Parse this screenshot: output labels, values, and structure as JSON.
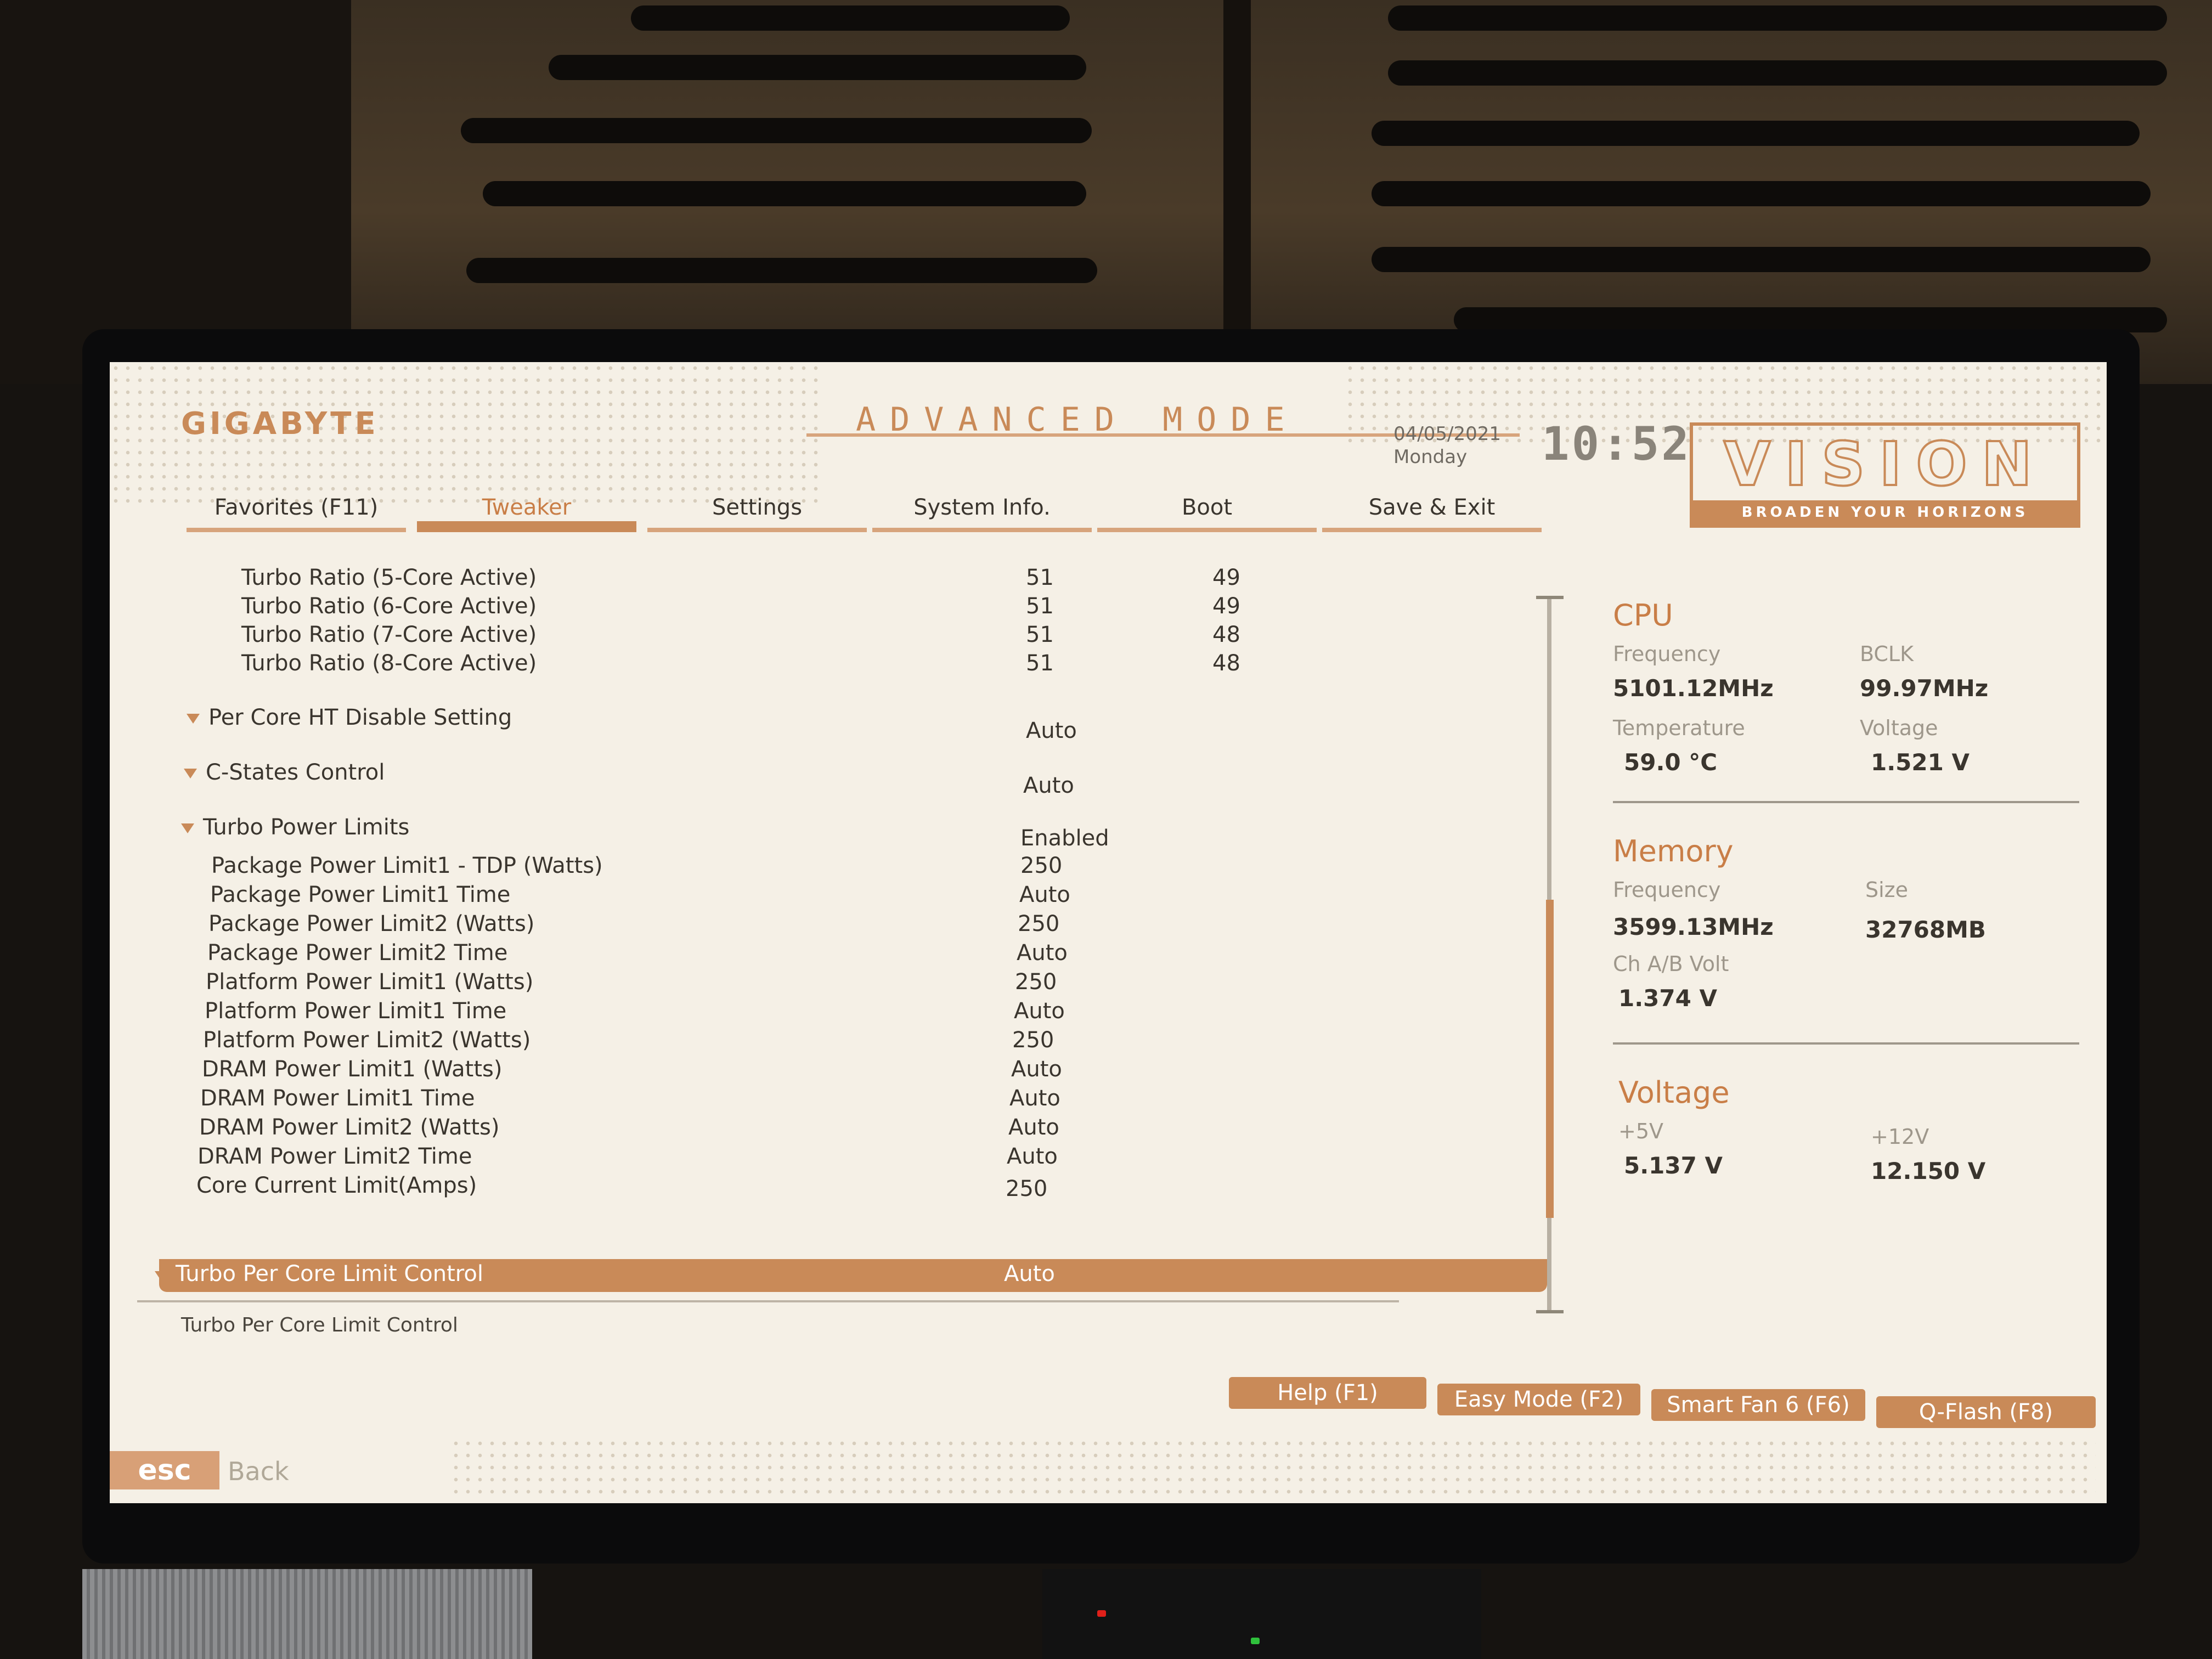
{
  "header": {
    "brand": "GIGABYTE",
    "mode_title": "ADVANCED MODE",
    "date": "04/05/2021",
    "day": "Monday",
    "time": "10:52",
    "badge_title": "VISION",
    "badge_subtitle": "BROADEN YOUR HORIZONS"
  },
  "tabs": [
    {
      "label": "Favorites (F11)",
      "active": false
    },
    {
      "label": "Tweaker",
      "active": true
    },
    {
      "label": "Settings",
      "active": false
    },
    {
      "label": "System Info.",
      "active": false
    },
    {
      "label": "Boot",
      "active": false
    },
    {
      "label": "Save & Exit",
      "active": false
    }
  ],
  "settings": {
    "turbo_ratios": [
      {
        "name": "Turbo Ratio (5-Core Active)",
        "value": "51",
        "current": "49"
      },
      {
        "name": "Turbo Ratio (6-Core Active)",
        "value": "51",
        "current": "49"
      },
      {
        "name": "Turbo Ratio (7-Core Active)",
        "value": "51",
        "current": "48"
      },
      {
        "name": "Turbo Ratio (8-Core Active)",
        "value": "51",
        "current": "48"
      }
    ],
    "per_core_ht": {
      "name": "Per Core HT Disable Setting",
      "value": "Auto"
    },
    "c_states": {
      "name": "C-States Control",
      "value": "Auto"
    },
    "turbo_power": {
      "name": "Turbo Power Limits",
      "value": "Enabled"
    },
    "power_items": [
      {
        "name": "Package Power Limit1 - TDP (Watts)",
        "value": "250"
      },
      {
        "name": "Package Power Limit1 Time",
        "value": "Auto"
      },
      {
        "name": "Package Power Limit2 (Watts)",
        "value": "250"
      },
      {
        "name": "Package Power Limit2 Time",
        "value": "Auto"
      },
      {
        "name": "Platform Power Limit1 (Watts)",
        "value": "250"
      },
      {
        "name": "Platform Power Limit1 Time",
        "value": "Auto"
      },
      {
        "name": "Platform Power Limit2 (Watts)",
        "value": "250"
      },
      {
        "name": "DRAM Power Limit1 (Watts)",
        "value": "Auto"
      },
      {
        "name": "DRAM Power Limit1 Time",
        "value": "Auto"
      },
      {
        "name": "DRAM Power Limit2 (Watts)",
        "value": "Auto"
      },
      {
        "name": "DRAM Power Limit2 Time",
        "value": "Auto"
      },
      {
        "name": "Core Current Limit(Amps)",
        "value": "250"
      }
    ],
    "selected": {
      "name": "Turbo Per Core Limit Control",
      "value": "Auto"
    },
    "description": "Turbo Per Core Limit Control"
  },
  "panel": {
    "cpu": {
      "title": "CPU",
      "frequency_label": "Frequency",
      "frequency": "5101.12MHz",
      "bclk_label": "BCLK",
      "bclk": "99.97MHz",
      "temperature_label": "Temperature",
      "temperature": "59.0 °C",
      "voltage_label": "Voltage",
      "voltage": "1.521 V"
    },
    "memory": {
      "title": "Memory",
      "frequency_label": "Frequency",
      "frequency": "3599.13MHz",
      "size_label": "Size",
      "size": "32768MB",
      "volt_label": "Ch A/B Volt",
      "volt": "1.374 V"
    },
    "voltage": {
      "title": "Voltage",
      "v5_label": "+5V",
      "v5": "5.137 V",
      "v12_label": "+12V",
      "v12": "12.150 V"
    }
  },
  "footer": {
    "help": "Help (F1)",
    "easy_mode": "Easy Mode (F2)",
    "smart_fan": "Smart Fan 6 (F6)",
    "qflash": "Q-Flash (F8)",
    "esc": "esc",
    "back": "Back"
  },
  "colors": {
    "accent": "#c98a58",
    "background": "#f5f0e6",
    "text": "#3a352e"
  }
}
